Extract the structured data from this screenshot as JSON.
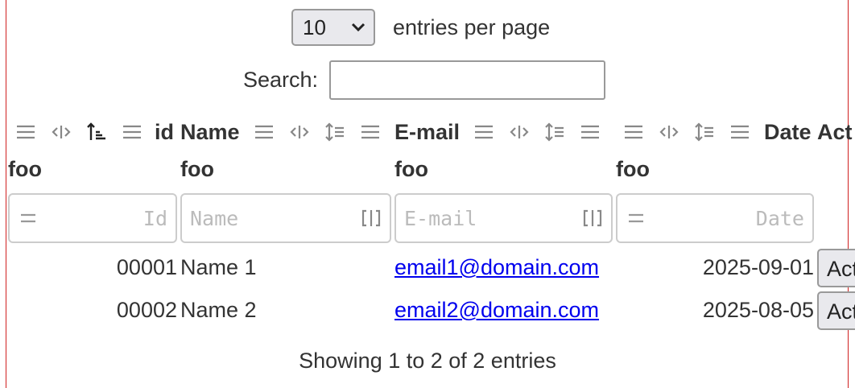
{
  "length": {
    "selected": "10",
    "label": "entries per page"
  },
  "search": {
    "label": "Search:",
    "value": ""
  },
  "columns": [
    {
      "title": "id",
      "subtitle": "foo",
      "placeholder": "Id"
    },
    {
      "title": "Name",
      "subtitle": "foo",
      "placeholder": "Name"
    },
    {
      "title": "E-mail",
      "subtitle": "foo",
      "placeholder": "E-mail"
    },
    {
      "title": "Date",
      "subtitle": "foo",
      "placeholder": "Date"
    },
    {
      "title": "Act"
    }
  ],
  "rows": [
    {
      "id": "00001",
      "name": "Name 1",
      "email": "email1@domain.com",
      "date": "2025-09-01",
      "action": "Act"
    },
    {
      "id": "00002",
      "name": "Name 2",
      "email": "email2@domain.com",
      "date": "2025-08-05",
      "action": "Act"
    }
  ],
  "info": "Showing 1 to 2 of 2 entries",
  "icons": [
    "menu-icon",
    "columns-icon",
    "sort-ascending-icon",
    "sort-icon",
    "equals-icon",
    "resize-icon",
    "chevron-down-icon"
  ],
  "colors": {
    "frame": "#d02020",
    "link": "#0000ee"
  }
}
